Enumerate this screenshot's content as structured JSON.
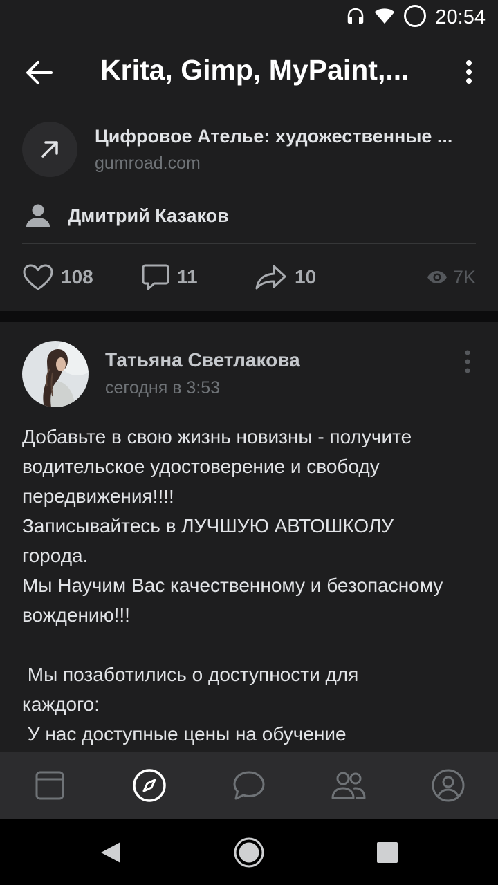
{
  "status_bar": {
    "time": "20:54"
  },
  "header": {
    "title": "Krita, Gimp, MyPaint,..."
  },
  "link_card": {
    "title": "Цифровое Ателье: художественные ...",
    "domain": "gumroad.com",
    "author": "Дмитрий Казаков"
  },
  "stats": {
    "likes": "108",
    "comments": "11",
    "shares": "10",
    "views": "7K"
  },
  "post": {
    "author": "Татьяна Светлакова",
    "time": "сегодня в 3:53",
    "lines": [
      "Добавьте в свою жизнь новизны - получите",
      "водительское удостоверение и свободу",
      "передвижения!!!!",
      "Записывайтесь в ЛУЧШУЮ АВТОШКОЛУ",
      "города.",
      "Мы Научим Вас качественному и безопасному",
      "вождению!!!",
      "",
      " Мы позаботились о доступности для",
      "каждого:",
      " У нас доступные цены на обучение"
    ]
  },
  "tabbar": {
    "icons": [
      "news-icon",
      "discover-icon",
      "messages-icon",
      "friends-icon",
      "profile-icon"
    ],
    "active_index": 1
  },
  "colors": {
    "background": "#19191a",
    "card": "#1e1e1f",
    "tabbar": "#2c2c2e",
    "text_primary": "#e1e3e6",
    "text_secondary": "#6f7377",
    "icon": "#a9acb0",
    "active_tab": "#ffffff"
  }
}
